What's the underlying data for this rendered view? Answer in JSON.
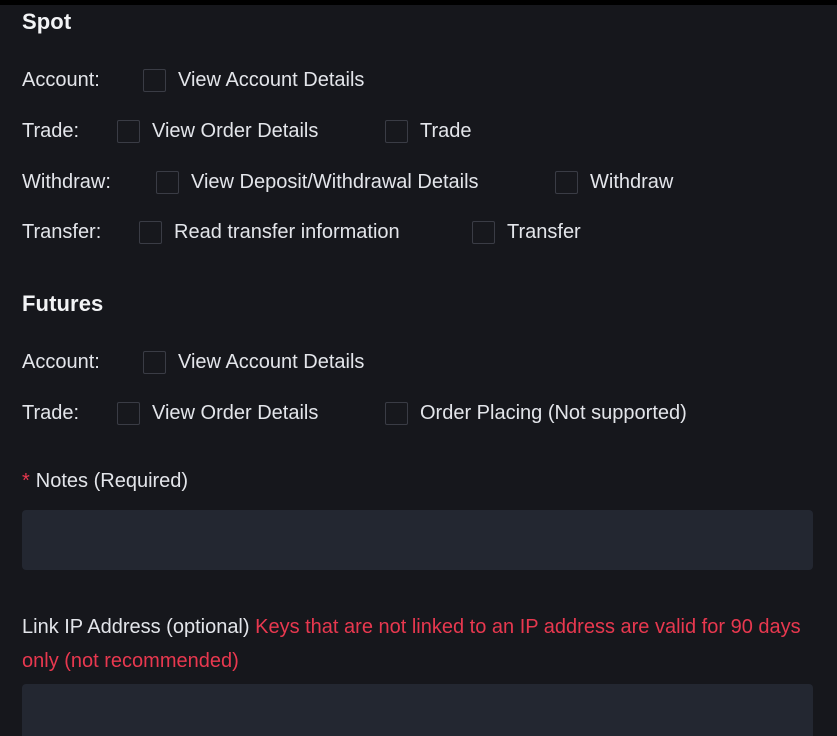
{
  "spot": {
    "title": "Spot",
    "rows": {
      "account": {
        "label": "Account:",
        "options": [
          "View Account Details"
        ]
      },
      "trade": {
        "label": "Trade:",
        "options": [
          "View Order Details",
          "Trade"
        ]
      },
      "withdraw": {
        "label": "Withdraw:",
        "options": [
          "View Deposit/Withdrawal Details",
          "Withdraw"
        ]
      },
      "transfer": {
        "label": "Transfer:",
        "options": [
          "Read transfer information",
          "Transfer"
        ]
      }
    }
  },
  "futures": {
    "title": "Futures",
    "rows": {
      "account": {
        "label": "Account:",
        "options": [
          "View Account Details"
        ]
      },
      "trade": {
        "label": "Trade:",
        "options": [
          "View Order Details",
          "Order Placing (Not supported)"
        ]
      }
    }
  },
  "notes": {
    "required_mark": "*",
    "label": "Notes (Required)",
    "value": ""
  },
  "ip": {
    "label": "Link IP Address (optional)",
    "warning": "Keys that are not linked to an IP address are valid for 90 days only (not recommended)",
    "value": ""
  },
  "colors": {
    "background": "#16171c",
    "input_background": "#232731",
    "checkbox_border": "#3a3c45",
    "text": "#e3e5ea",
    "warning": "#e8384f"
  }
}
